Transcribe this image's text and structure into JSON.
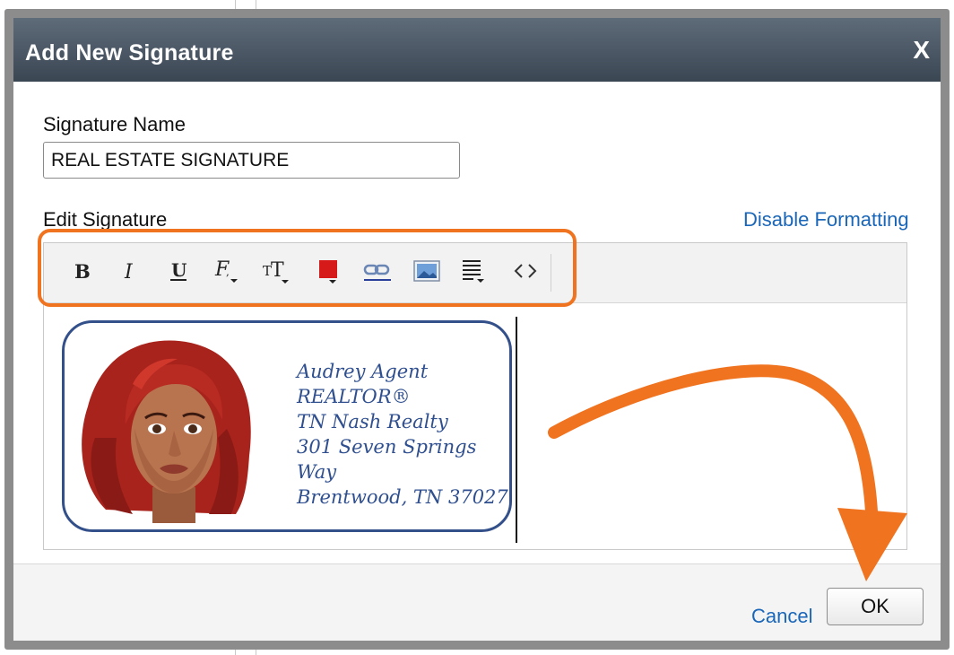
{
  "dialog": {
    "title": "Add New Signature",
    "close_label": "X"
  },
  "form": {
    "name_label": "Signature Name",
    "name_value": "REAL ESTATE SIGNATURE",
    "edit_label": "Edit Signature",
    "disable_formatting": "Disable Formatting"
  },
  "toolbar": {
    "tools": [
      "bold-icon",
      "italic-icon",
      "underline-icon",
      "font-family-icon",
      "font-size-icon",
      "font-color-icon",
      "link-icon",
      "image-icon",
      "align-icon",
      "source-code-icon"
    ],
    "font_color": "#d61a1a"
  },
  "signature": {
    "lines": [
      "Audrey Agent",
      "REALTOR®",
      "TN Nash Realty",
      "301 Seven Springs Way",
      "Brentwood, TN 37027"
    ]
  },
  "footer": {
    "cancel": "Cancel",
    "ok": "OK"
  },
  "colors": {
    "accent": "#f07320",
    "link": "#1a66b8",
    "title_bar": "#4a5562",
    "signature_border": "#34508a"
  }
}
